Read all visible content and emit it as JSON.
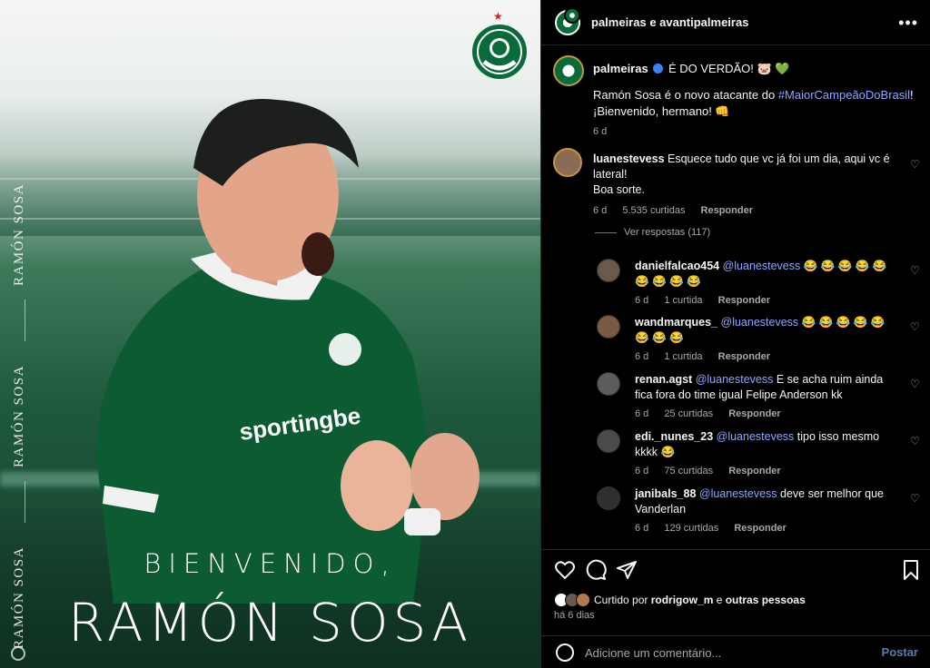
{
  "image": {
    "side_labels": [
      "RAMÓN SOSA",
      "RAMÓN SOSA",
      "RAMÓN SOSA"
    ],
    "headline_top": "BIENVENIDO,",
    "headline_name": "RAMÓN SOSA",
    "shirt_sponsor": "sportingbe",
    "crest_text": "PALMEIRAS",
    "brand_colors": {
      "green": "#0a6b3a",
      "star": "#c62a2a"
    }
  },
  "post": {
    "header_title": "palmeiras e avantipalmeiras",
    "author": "palmeiras",
    "caption_title": "É DO VERDÃO! 🐷 💚",
    "caption_line1_prefix": "Ramón Sosa é o novo atacante do ",
    "caption_hashtag": "#MaiorCampeãoDoBrasil",
    "caption_line1_suffix": "!",
    "caption_line2": "¡Bienvenido, hermano! 👊",
    "caption_age": "6 d"
  },
  "comments": [
    {
      "user": "luanestevess",
      "text": "Esquece tudo que vc já foi um dia, aqui vc é lateral!",
      "text2": "Boa sorte.",
      "age": "6 d",
      "likes": "5.535 curtidas",
      "reply_label": "Responder",
      "view_replies": "Ver respostas (117)"
    }
  ],
  "replies": [
    {
      "user": "danielfalcao454",
      "mention": "@luanestevess",
      "text": " 😂 😂 😂 😂 😂 😂 😂 😂 😂",
      "age": "6 d",
      "likes": "1 curtida",
      "reply_label": "Responder"
    },
    {
      "user": "wandmarques_",
      "mention": "@luanestevess",
      "text": " 😂 😂 😂 😂 😂 😂 😂 😂",
      "age": "6 d",
      "likes": "1 curtida",
      "reply_label": "Responder"
    },
    {
      "user": "renan.agst",
      "mention": "@luanestevess",
      "text": " E se acha ruim ainda fica fora do time igual Felipe Anderson kk",
      "age": "6 d",
      "likes": "25 curtidas",
      "reply_label": "Responder"
    },
    {
      "user": "edi._nunes_23",
      "mention": "@luanestevess",
      "text": " tipo isso mesmo kkkk 😂",
      "age": "6 d",
      "likes": "75 curtidas",
      "reply_label": "Responder"
    },
    {
      "user": "janibals_88",
      "mention": "@luanestevess",
      "text": " deve ser melhor que Vanderlan",
      "age": "6 d",
      "likes": "129 curtidas",
      "reply_label": "Responder"
    }
  ],
  "footer": {
    "liked_by_prefix": "Curtido por ",
    "liked_by_user": "rodrigow_m",
    "liked_by_suffix": " e ",
    "liked_by_others": "outras pessoas",
    "time_ago": "há 6 dias",
    "comment_placeholder": "Adicione um comentário...",
    "post_label": "Postar"
  }
}
